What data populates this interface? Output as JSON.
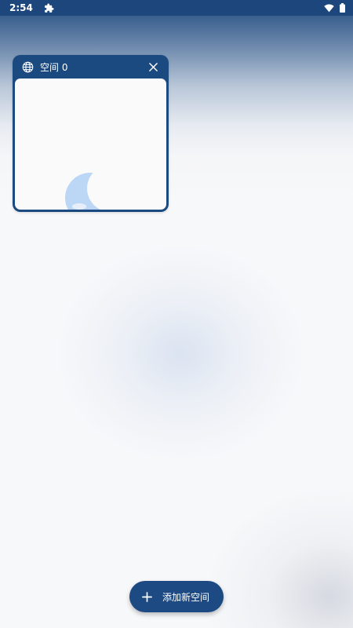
{
  "status_bar": {
    "time": "2:54",
    "icons": [
      "puzzle-icon",
      "wifi-icon",
      "battery-icon"
    ]
  },
  "space_card": {
    "icon": "globe-icon",
    "title": "空间 0",
    "close_icon": "close-icon",
    "preview_icon": "moon-icon"
  },
  "add_space_button": {
    "icon": "plus-icon",
    "label": "添加新空间"
  },
  "colors": {
    "primary": "#1d4a82",
    "status_bar": "#1d477c",
    "preview_bg": "#fafafa",
    "moon": "#bcd6f5"
  }
}
